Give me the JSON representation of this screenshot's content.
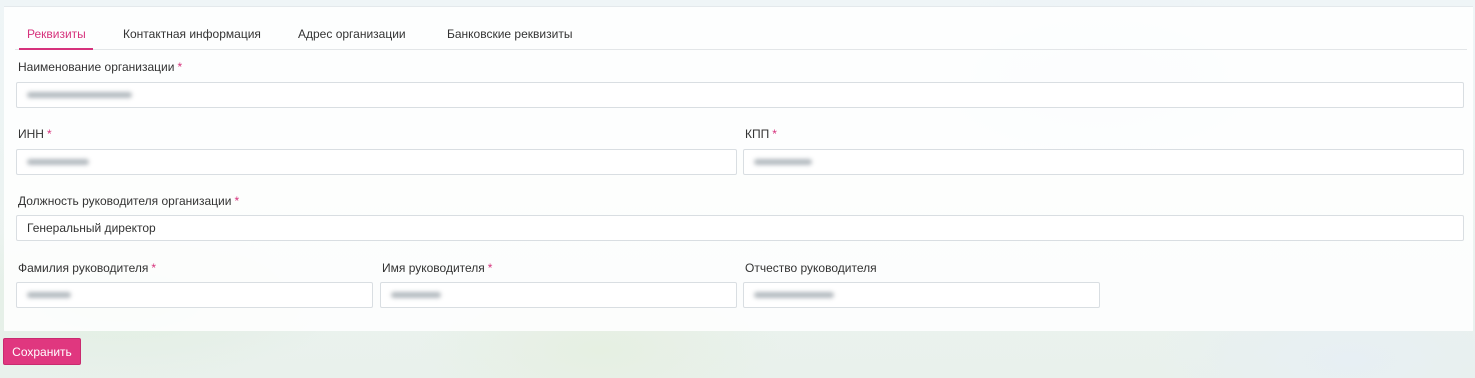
{
  "tabs": [
    {
      "label": "Реквизиты",
      "active": true
    },
    {
      "label": "Контактная информация",
      "active": false
    },
    {
      "label": "Адрес организации",
      "active": false
    },
    {
      "label": "Банковские реквизиты",
      "active": false
    }
  ],
  "form": {
    "org_name": {
      "label": "Наименование организации",
      "required_mark": "*",
      "value": ""
    },
    "inn": {
      "label": "ИНН",
      "required_mark": "*",
      "value": ""
    },
    "kpp": {
      "label": "КПП",
      "required_mark": "*",
      "value": ""
    },
    "position": {
      "label": "Должность руководителя организации",
      "required_mark": "*",
      "value": "Генеральный директор"
    },
    "last_name": {
      "label": "Фамилия руководителя",
      "required_mark": "*",
      "value": ""
    },
    "first_name": {
      "label": "Имя руководителя",
      "required_mark": "*",
      "value": ""
    },
    "patronymic": {
      "label": "Отчество руководителя",
      "value": ""
    }
  },
  "actions": {
    "save_label": "Сохранить"
  },
  "colors": {
    "accent": "#d6327c",
    "button": "#e0377f"
  }
}
